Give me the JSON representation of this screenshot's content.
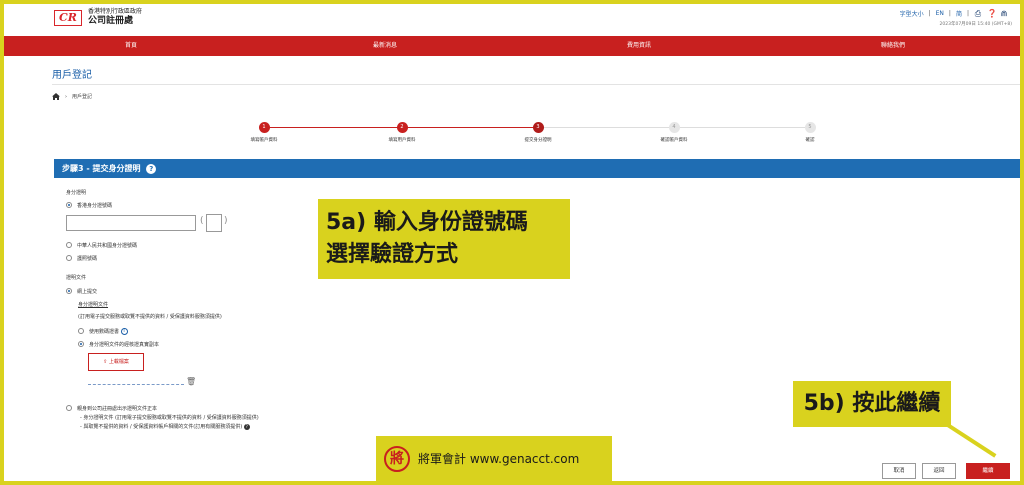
{
  "header": {
    "logo_mark": "CR",
    "logo_line1": "香港特別行政區政府",
    "logo_line2": "公司註冊處",
    "font_size_label": "字型大小",
    "lang_en": "EN",
    "lang_sc": "简",
    "datetime": "2023年07月09日 15:40 (GMT+8)",
    "icons": [
      "print-icon",
      "help-icon",
      "share-icon"
    ]
  },
  "nav": {
    "items": [
      "首頁",
      "最新消息",
      "費用資訊",
      "聯絡我們"
    ]
  },
  "page": {
    "title": "用戶登記",
    "breadcrumb": "用戶登記"
  },
  "steps": [
    {
      "num": "1",
      "label": "填寫帳戶資料",
      "state": "done"
    },
    {
      "num": "2",
      "label": "填寫用戶資料",
      "state": "done"
    },
    {
      "num": "3",
      "label": "提交身分證明",
      "state": "current"
    },
    {
      "num": "4",
      "label": "確認帳戶資料",
      "state": "pending"
    },
    {
      "num": "5",
      "label": "確認",
      "state": "pending"
    }
  ],
  "section": {
    "title": "步驟3 - 提交身分證明",
    "help": "?"
  },
  "form": {
    "identity_label": "身分證明",
    "opt_hkid": "香港身分證號碼",
    "opt_mainland": "中華人民共和國身分證號碼",
    "opt_passport": "護照號碼",
    "doc_label": "證明文件",
    "opt_online": "網上提交",
    "doc_sub_label": "身分證明文件",
    "doc_note": "(訂用電子提交服務或取覽不提供的資料 / 受保護資料服務須提供)",
    "opt_ekey": "使用數碼證書",
    "opt_copy": "身分證明文件的經核證真實副本",
    "upload_label": "上載檔案",
    "opt_inperson": "親身到公司註冊處出示證明文件正本",
    "inperson_note1": "- 身分證明文件 (訂用電子提交服務或取覽不提供的資料 / 受保護資料服務須提供)",
    "inperson_note2": "- 與取覽不提供的資料 / 受保護資料帳戶相關的文件(訂用有關服務須提供)"
  },
  "buttons": {
    "cancel": "取消",
    "back": "返回",
    "continue": "繼續"
  },
  "annotations": {
    "callout_a_line1": "5a) 輸入身份證號碼",
    "callout_a_line2": "選擇驗證方式",
    "callout_b": "5b) 按此繼續",
    "brand_seal": "將",
    "brand_text": "將軍會計 www.genacct.com"
  },
  "colors": {
    "brand_red": "#c8201f",
    "section_blue": "#1f6db3",
    "highlight_yellow": "#d9d21e"
  }
}
